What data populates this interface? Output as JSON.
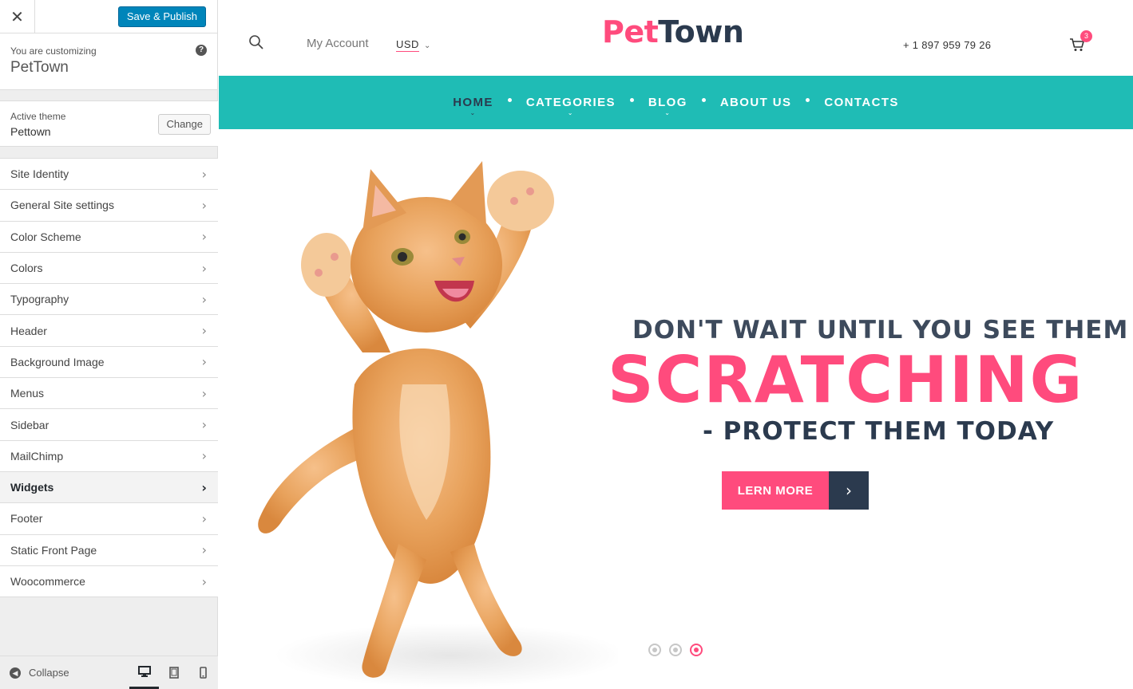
{
  "customizer": {
    "save_label": "Save & Publish",
    "customizing_label": "You are customizing",
    "site_name": "PetTown",
    "active_theme_label": "Active theme",
    "theme_name": "Pettown",
    "change_label": "Change",
    "menu": [
      {
        "label": "Site Identity"
      },
      {
        "label": "General Site settings"
      },
      {
        "label": "Color Scheme"
      },
      {
        "label": "Colors"
      },
      {
        "label": "Typography"
      },
      {
        "label": "Header"
      },
      {
        "label": "Background Image"
      },
      {
        "label": "Menus"
      },
      {
        "label": "Sidebar"
      },
      {
        "label": "MailChimp"
      },
      {
        "label": "Widgets"
      },
      {
        "label": "Footer"
      },
      {
        "label": "Static Front Page"
      },
      {
        "label": "Woocommerce"
      }
    ],
    "active_menu_item": "Widgets",
    "collapse_label": "Collapse",
    "active_device": "desktop"
  },
  "site": {
    "my_account": "My Account",
    "currency": "USD",
    "logo_pet": "Pet",
    "logo_town": "Town",
    "phone": "+ 1 897 959 79 26",
    "cart_count": "3",
    "nav": [
      {
        "label": "HOME",
        "has_sub": true
      },
      {
        "label": "CATEGORIES",
        "has_sub": true
      },
      {
        "label": "BLOG",
        "has_sub": true
      },
      {
        "label": "ABOUT US",
        "has_sub": false
      },
      {
        "label": "CONTACTS",
        "has_sub": false
      }
    ],
    "hero": {
      "line1": "DON'T WAIT UNTIL YOU SEE THEM",
      "line2": "SCRATCHING",
      "line3": "- PROTECT THEM TODAY",
      "button": "LERN MORE",
      "slides": 3,
      "active_slide": 3
    }
  },
  "colors": {
    "accent_pink": "#ff4b7d",
    "nav_teal": "#1fbcb5",
    "dark_navy": "#2b3a4e",
    "wp_blue": "#0085ba"
  }
}
